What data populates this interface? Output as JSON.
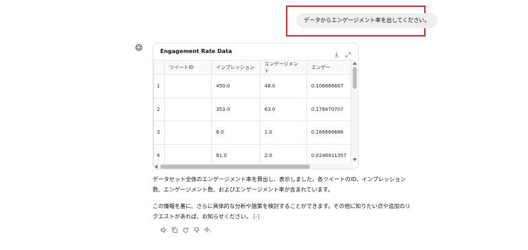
{
  "user_message": {
    "text": "データからエンゲージメント率を出してください。"
  },
  "assistant": {
    "avatar_icon": "openai-logo-icon",
    "card": {
      "title": "Engagement Rate Data",
      "download_icon": "download-icon",
      "expand_icon": "expand-icon",
      "columns": [
        "",
        "ツイートID",
        "インプレッション",
        "エンゲージメント",
        "エンゲー"
      ],
      "rows": [
        {
          "index": "1",
          "tweet_id": "",
          "impressions": "450.0",
          "engagements": "48.0",
          "rate": "0.106666667"
        },
        {
          "index": "2",
          "tweet_id": "",
          "impressions": "353.0",
          "engagements": "63.0",
          "rate": "0.178470707"
        },
        {
          "index": "3",
          "tweet_id": "",
          "impressions": "6.0",
          "engagements": "1.0",
          "rate": "0.166666666"
        },
        {
          "index": "4",
          "tweet_id": "",
          "impressions": "81.0",
          "engagements": "2.0",
          "rate": "0.0246911357"
        }
      ]
    },
    "paragraph1": "データセット全体のエンゲージメント率を算出し、表示しました。各ツイートのID、インプレッション数、エンゲージメント数、およびエンゲージメント率が含まれています。",
    "paragraph2": "この情報を基に、さらに具体的な分析や施策を検討することができます。その他に知りたい点や追加のリクエストがあれば、お知らせください。",
    "citation": "[-]",
    "action_icons": [
      "speaker-icon",
      "copy-icon",
      "regenerate-icon",
      "thumbs-down-icon",
      "sparkle-icon"
    ]
  },
  "colors": {
    "highlight": "#d9262b",
    "bubble": "#efefef",
    "link": "#2a6fdb"
  }
}
